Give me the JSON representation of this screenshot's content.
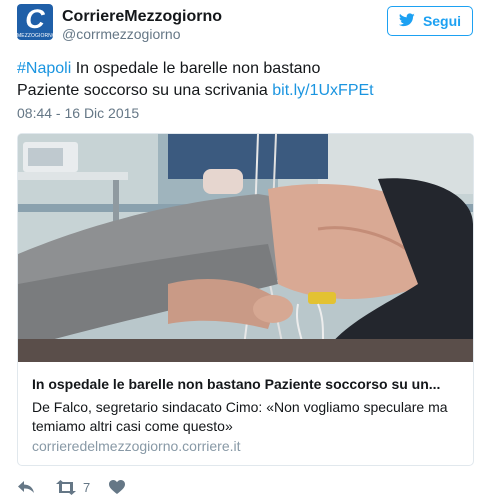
{
  "header": {
    "display_name": "CorriereMezzogiorno",
    "handle": "@corrmezzogiorno",
    "avatar_letter": "C",
    "avatar_brand": "MEZZOGIORNO",
    "follow_label": "Segui",
    "follow_icon": "twitter-bird-icon",
    "accent_color": "#1da1f2"
  },
  "tweet": {
    "hashtag": "#Napoli",
    "line1_text": " In ospedale le barelle non bastano",
    "line2_text": "Paziente soccorso su una scrivania ",
    "link": "bit.ly/1UxFPEt",
    "timestamp": "08:44 - 16 Dic 2015"
  },
  "card": {
    "image_icon": "photo-patient-on-desk",
    "title": "In ospedale le barelle non bastano Paziente soccorso su un...",
    "description": "De Falco, segretario sindacato Cimo: «Non vogliamo speculare ma temiamo altri casi come questo»",
    "url": "corrieredelmezzogiorno.corriere.it"
  },
  "actions": {
    "reply_icon": "reply-icon",
    "retweet_icon": "retweet-icon",
    "retweet_count": "7",
    "like_icon": "heart-icon"
  }
}
